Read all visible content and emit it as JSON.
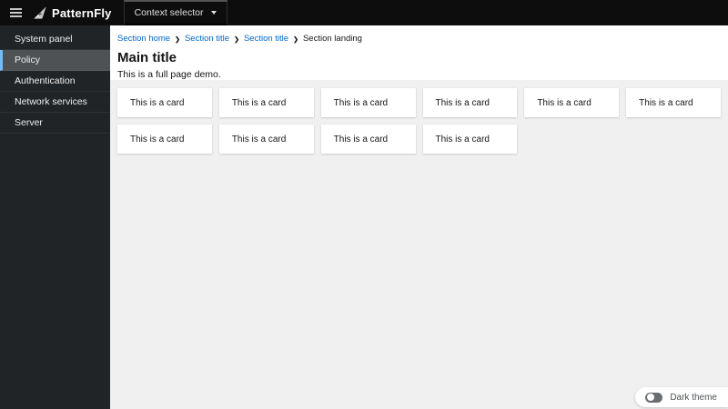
{
  "header": {
    "brand": "PatternFly",
    "context_selector_label": "Context selector"
  },
  "sidebar": {
    "items": [
      {
        "label": "System panel",
        "current": false
      },
      {
        "label": "Policy",
        "current": true
      },
      {
        "label": "Authentication",
        "current": false
      },
      {
        "label": "Network services",
        "current": false
      },
      {
        "label": "Server",
        "current": false
      }
    ]
  },
  "breadcrumb": {
    "items": [
      {
        "label": "Section home",
        "link": true
      },
      {
        "label": "Section title",
        "link": true
      },
      {
        "label": "Section title",
        "link": true
      },
      {
        "label": "Section landing",
        "link": false
      }
    ]
  },
  "main": {
    "title": "Main title",
    "description": "This is a full page demo.",
    "cards": [
      "This is a card",
      "This is a card",
      "This is a card",
      "This is a card",
      "This is a card",
      "This is a card",
      "This is a card",
      "This is a card",
      "This is a card",
      "This is a card"
    ]
  },
  "footer": {
    "dark_theme_label": "Dark theme",
    "dark_theme_enabled": false
  },
  "colors": {
    "masthead_bg": "#0d0d0d",
    "sidebar_bg": "#212427",
    "nav_current_bg": "#4f5255",
    "nav_current_accent": "#73bcf7",
    "link_blue": "#0066cc",
    "content_bg": "#f0f0f0",
    "card_bg": "#ffffff",
    "switch_track": "#6a6e73"
  }
}
